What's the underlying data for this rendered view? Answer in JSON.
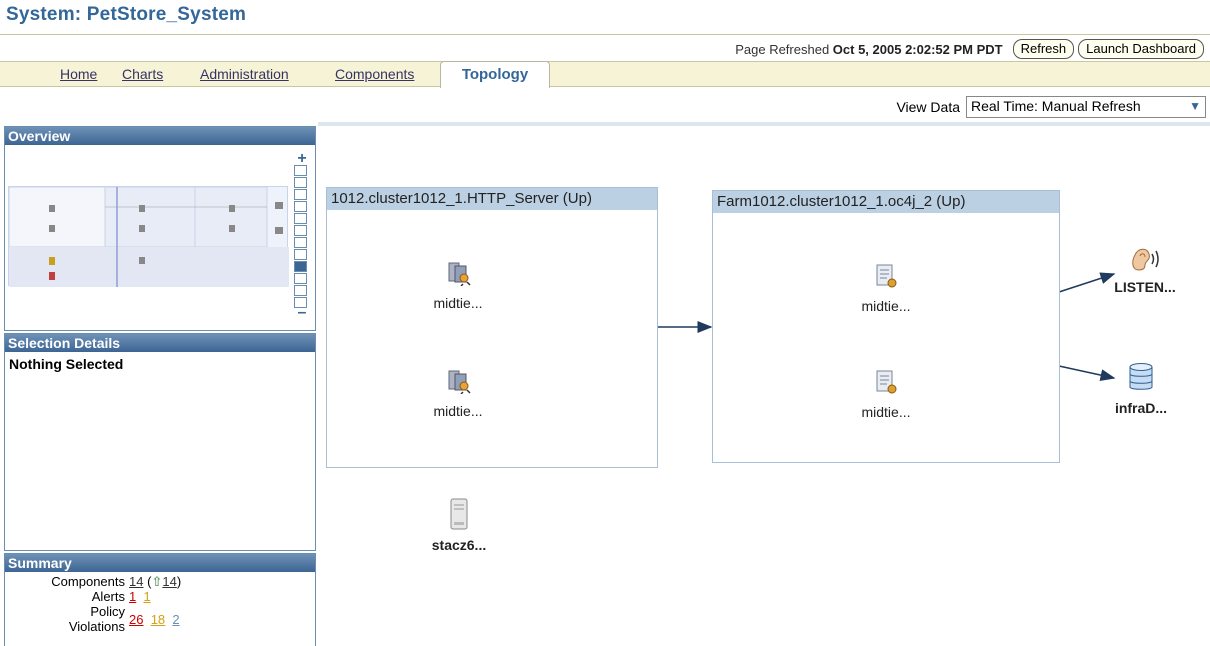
{
  "header": {
    "title": "System: PetStore_System",
    "refreshed_label": "Page Refreshed",
    "refreshed_time": "Oct 5, 2005 2:02:52 PM PDT",
    "refresh_button": "Refresh",
    "dashboard_button": "Launch Dashboard"
  },
  "tabs": [
    "Home",
    "Charts",
    "Administration",
    "Components",
    "Topology"
  ],
  "view": {
    "label": "View Data",
    "value": "Real Time: Manual Refresh"
  },
  "panels": {
    "overview": "Overview",
    "selection": "Selection Details",
    "selection_text": "Nothing Selected",
    "summary": "Summary"
  },
  "summary": {
    "components_label": "Components",
    "components_value": "14",
    "components_up": "14",
    "alerts_label": "Alerts",
    "alerts_critical": "1",
    "alerts_warning": "1",
    "policy_label_1": "Policy",
    "policy_label_2": "Violations",
    "policy_critical": "26",
    "policy_warning": "18",
    "policy_info": "2"
  },
  "topology": {
    "http_group": "1012.cluster1012_1.HTTP_Server (Up)",
    "oc4j_group": "Farm1012.cluster1012_1.oc4j_2 (Up)",
    "http_node_1": "midtie...",
    "http_node_2": "midtie...",
    "oc4j_node_1": "midtie...",
    "oc4j_node_2": "midtie...",
    "host_node": "stacz6...",
    "listener_node": "LISTEN...",
    "db_node": "infraD..."
  },
  "colors": {
    "brand": "#336699",
    "panel_header": "#3d6594",
    "group_header": "#bcd0e3",
    "critical": "#cc0000",
    "warning": "#d4a017"
  }
}
